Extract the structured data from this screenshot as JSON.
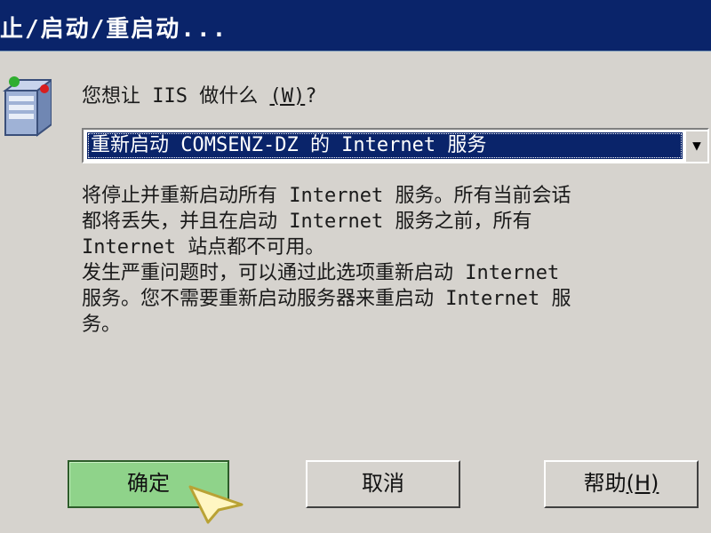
{
  "window": {
    "title": "止/启动/重启动..."
  },
  "dialog": {
    "question_prefix": "您想让 IIS 做什么",
    "question_hotkey": "(W)",
    "question_suffix": "?",
    "selected_action": "重新启动 COMSENZ-DZ 的 Internet 服务",
    "description_lines": [
      "将停止并重新启动所有 Internet 服务。所有当前会话",
      "都将丢失，并且在启动 Internet 服务之前，所有",
      "Internet 站点都不可用。",
      "发生严重问题时，可以通过此选项重新启动 Internet",
      "服务。您不需要重新启动服务器来重启动 Internet 服",
      "务。"
    ]
  },
  "buttons": {
    "ok": "确定",
    "cancel": "取消",
    "help_label": "帮助",
    "help_hotkey": "(H)"
  },
  "icons": {
    "app_icon": "iis-server-icon",
    "dropdown": "chevron-down-icon",
    "pointer": "cursor-arrow-icon"
  },
  "colors": {
    "titlebar": "#0a246a",
    "dialog_bg": "#d6d3ce",
    "selection": "#0a246a",
    "ok_highlight": "#8fd38a"
  }
}
